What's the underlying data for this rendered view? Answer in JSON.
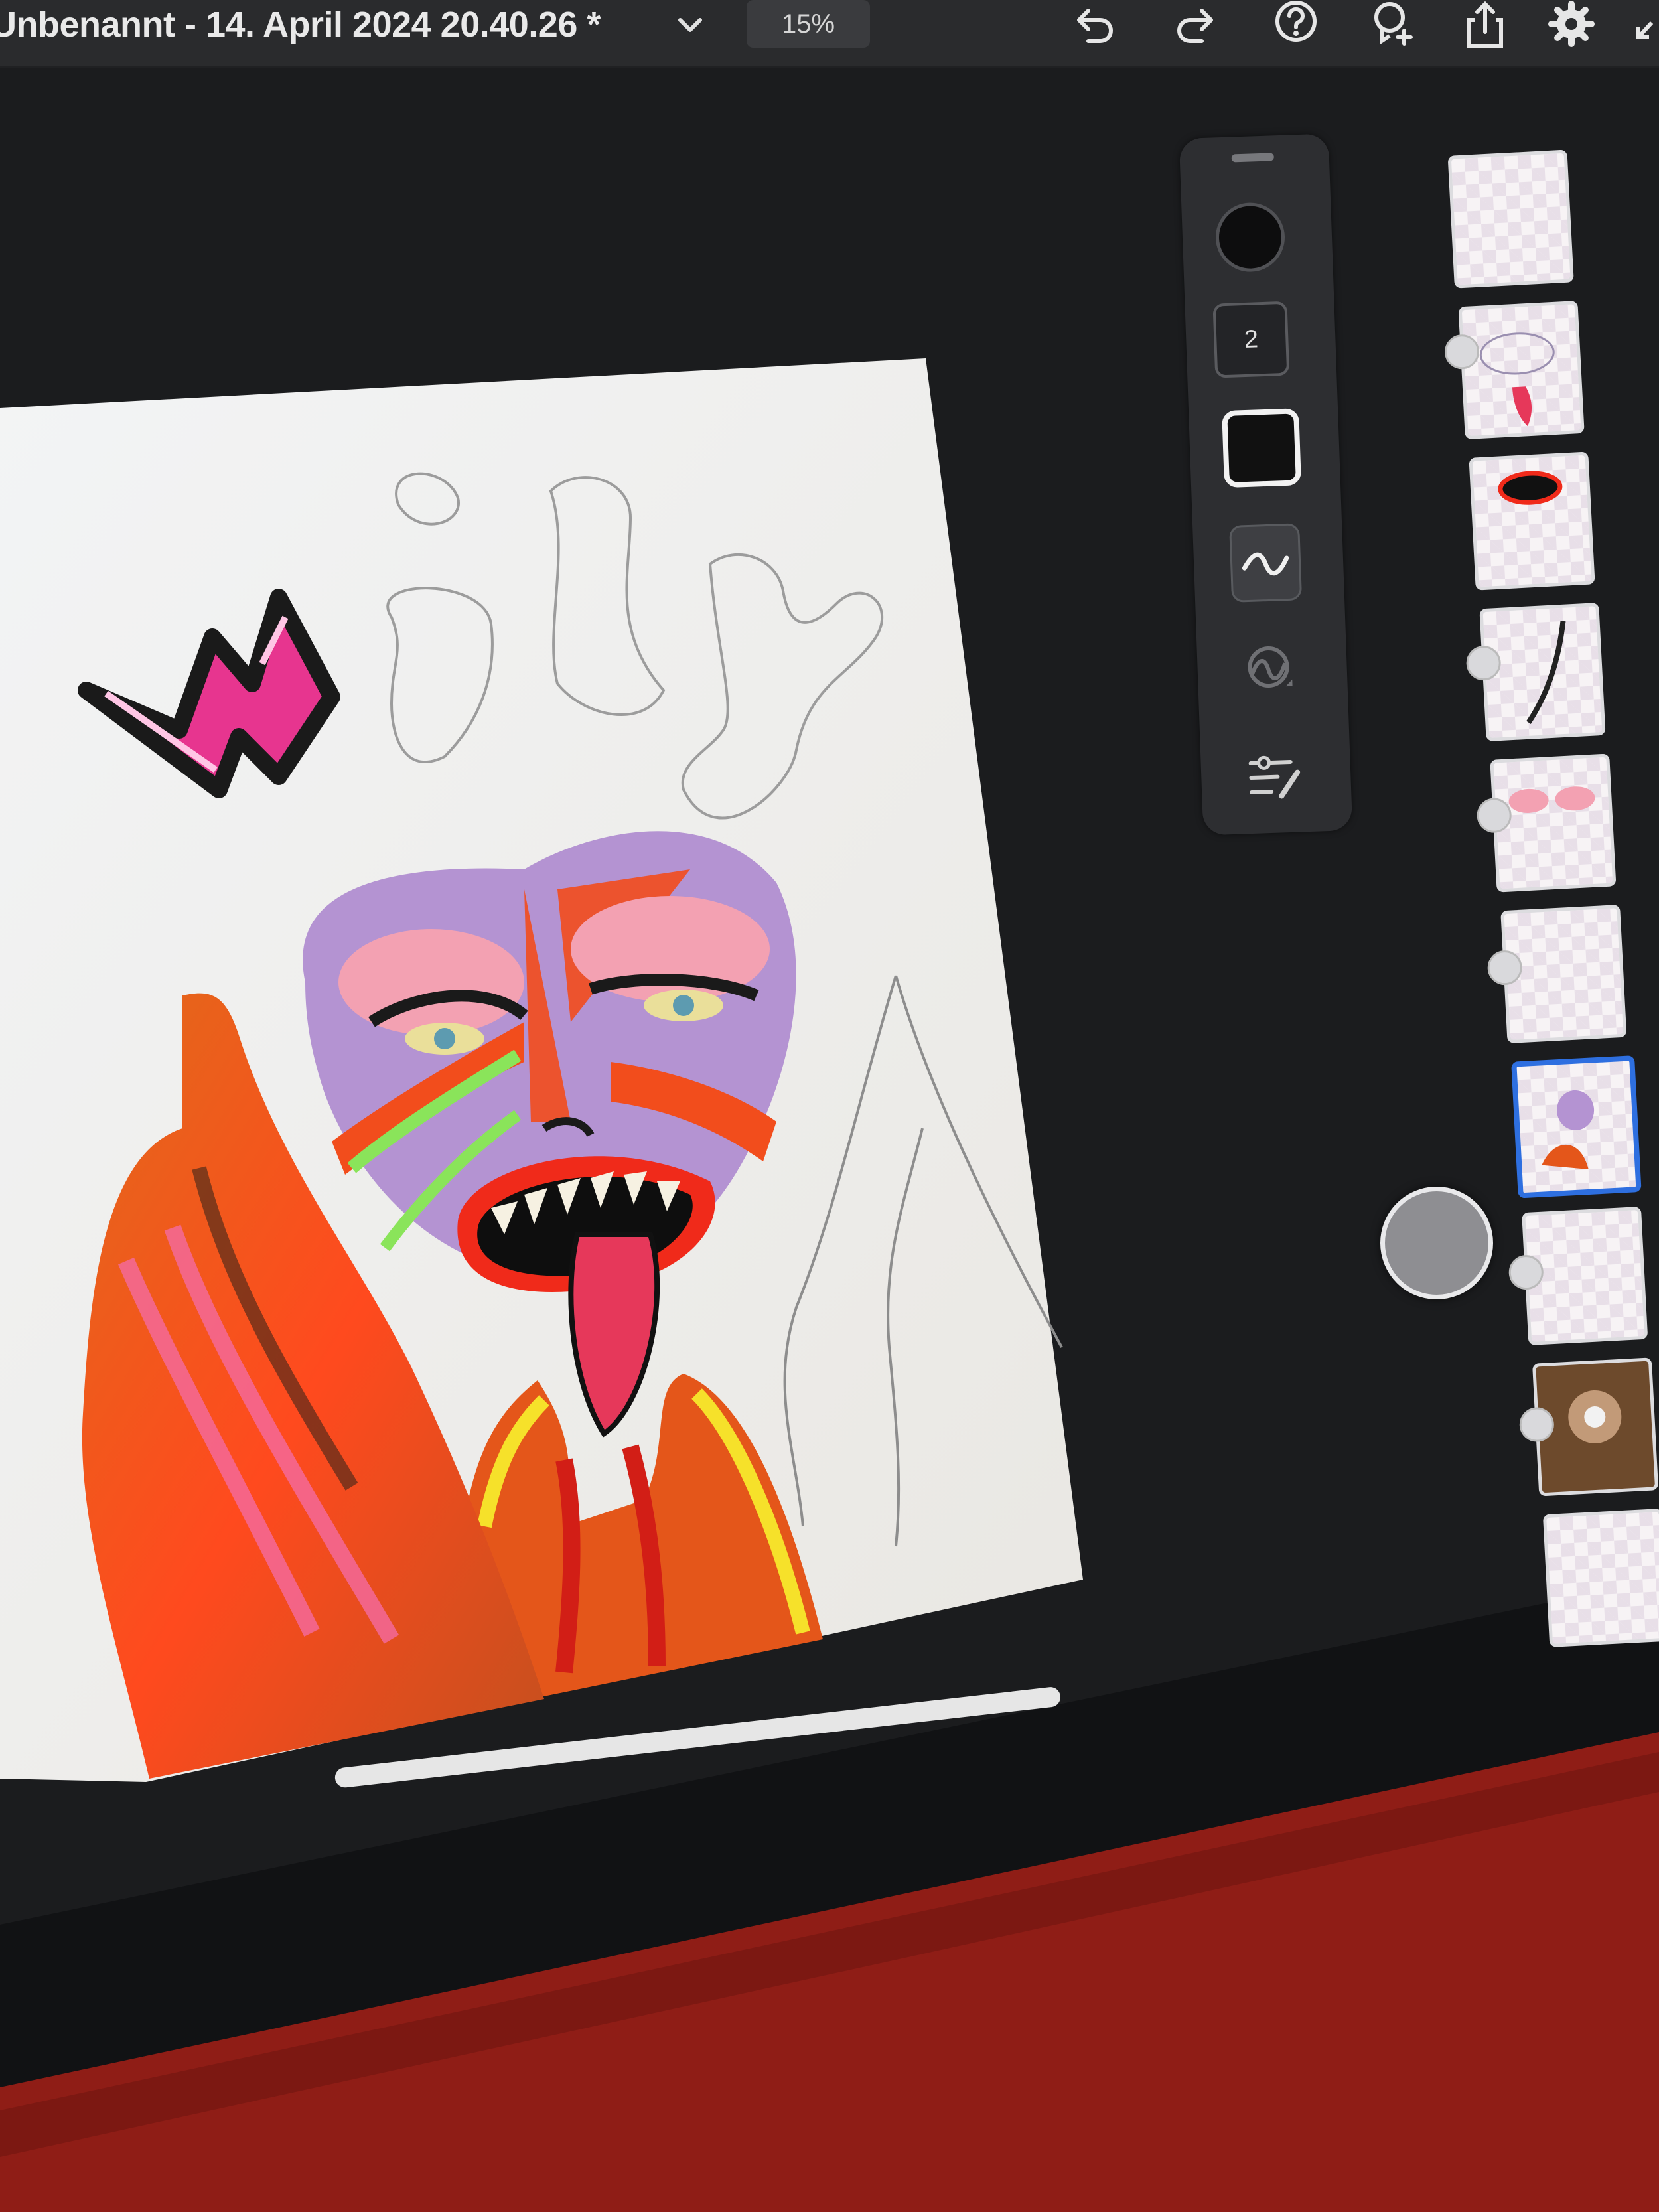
{
  "document": {
    "title": "Unbenannt - 14. April 2024 20.40.26 *",
    "zoom": "15%"
  },
  "toolbar": {
    "icons": [
      "undo-icon",
      "redo-icon",
      "help-icon",
      "invite-icon",
      "share-icon",
      "settings-icon"
    ]
  },
  "brush_panel": {
    "opacity_value": "2",
    "current_color": "#111111"
  },
  "layers": {
    "count_visible": 10,
    "selected_index": 6
  },
  "canvas": {
    "sketch_text": "wily"
  },
  "colors": {
    "accent": "#2e6fe0",
    "app_background": "#1b1c1e",
    "topbar": "#2a2b2d",
    "case": "#8f1d16"
  }
}
